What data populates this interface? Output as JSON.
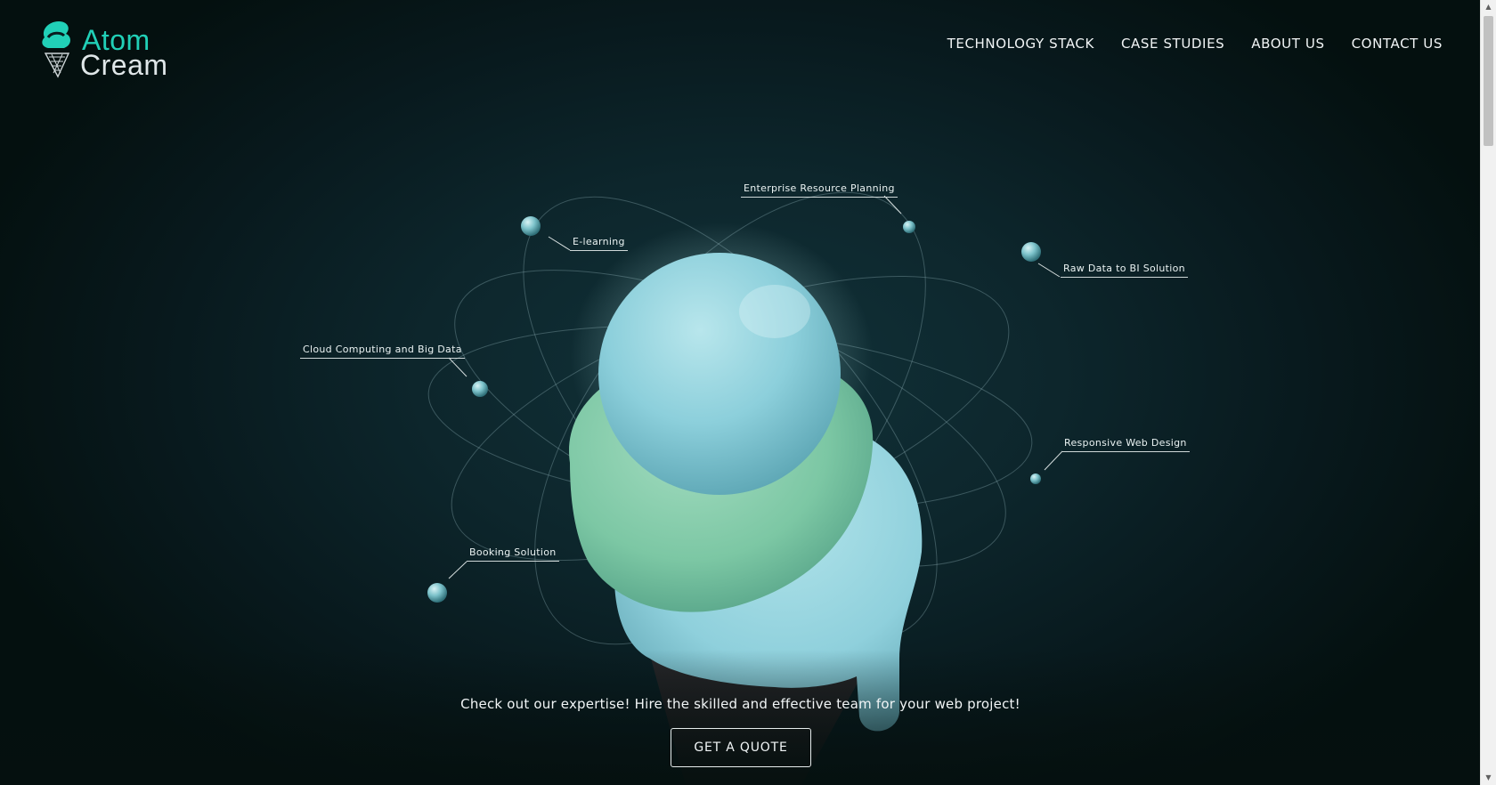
{
  "brand": {
    "line1": "Atom",
    "line2": "Cream",
    "accent": "#21d0b7"
  },
  "nav": {
    "items": [
      "TECHNOLOGY STACK",
      "CASE STUDIES",
      "ABOUT US",
      "CONTACT US"
    ]
  },
  "hero": {
    "labels": {
      "elearning": "E-learning",
      "erp": "Enterprise Resource Planning",
      "bi": "Raw Data to BI Solution",
      "cloud": "Cloud Computing and Big Data",
      "responsive": "Responsive Web Design",
      "booking": "Booking Solution"
    },
    "tagline": "Check out our expertise! Hire the skilled and effective team for your web project!",
    "cta": "GET A QUOTE"
  },
  "colors": {
    "scoop_top": "#8fd3dc",
    "scoop_mid": "#7fcaa6",
    "background": "#0d262c"
  }
}
